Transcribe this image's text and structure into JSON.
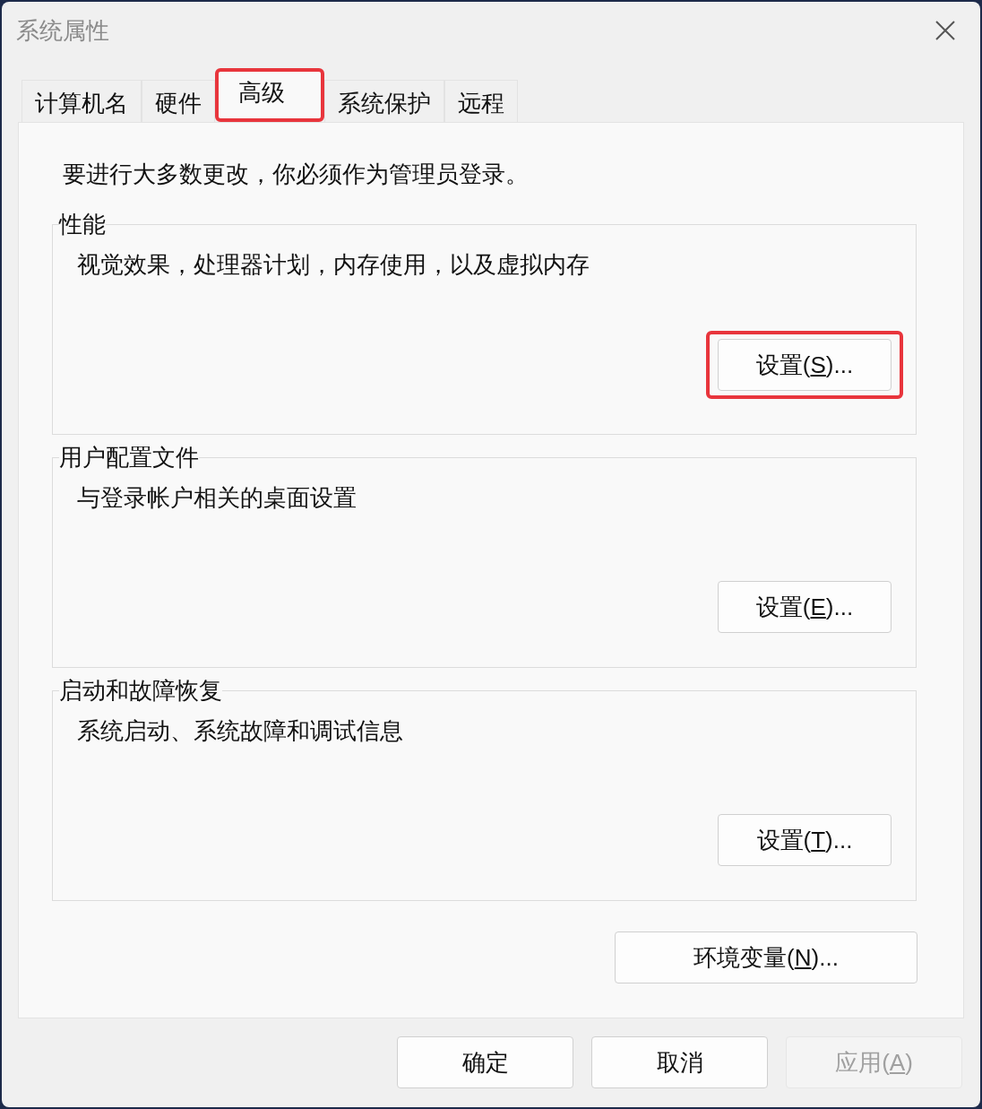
{
  "window": {
    "title": "系统属性"
  },
  "tabs": [
    {
      "label": "计算机名",
      "selected": false,
      "highlighted": false
    },
    {
      "label": "硬件",
      "selected": false,
      "highlighted": false
    },
    {
      "label": "高级",
      "selected": true,
      "highlighted": true
    },
    {
      "label": "系统保护",
      "selected": false,
      "highlighted": false
    },
    {
      "label": "远程",
      "selected": false,
      "highlighted": false
    }
  ],
  "notice": "要进行大多数更改，你必须作为管理员登录。",
  "groups": [
    {
      "title": "性能",
      "description": "视觉效果，处理器计划，内存使用，以及虚拟内存",
      "button": {
        "label": "设置(S)...",
        "highlighted": true
      }
    },
    {
      "title": "用户配置文件",
      "description": "与登录帐户相关的桌面设置",
      "button": {
        "label": "设置(E)...",
        "highlighted": false
      }
    },
    {
      "title": "启动和故障恢复",
      "description": "系统启动、系统故障和调试信息",
      "button": {
        "label": "设置(T)...",
        "highlighted": false
      }
    }
  ],
  "environment_button": {
    "label": "环境变量(N)..."
  },
  "footer_buttons": [
    {
      "label": "确定",
      "disabled": false
    },
    {
      "label": "取消",
      "disabled": false
    },
    {
      "label": "应用(A)",
      "disabled": true
    }
  ]
}
